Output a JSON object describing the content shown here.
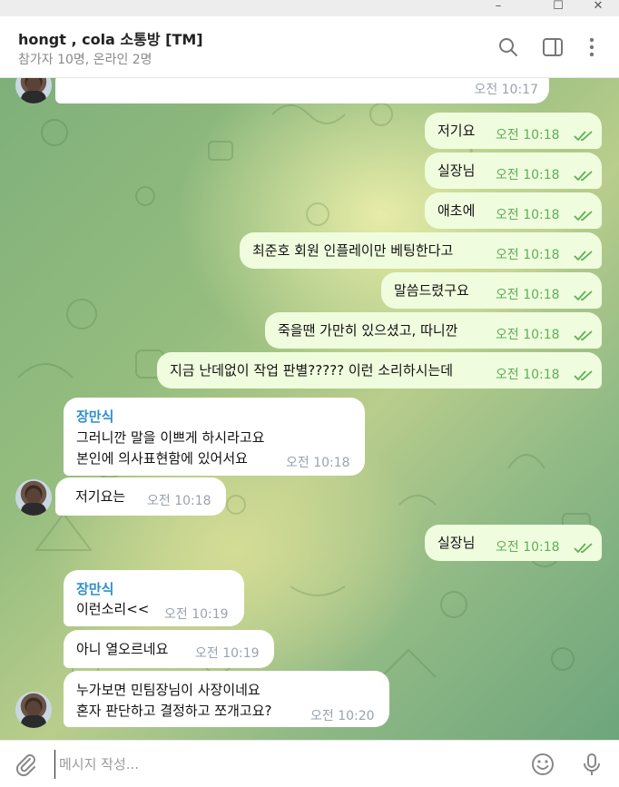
{
  "window": {
    "minimize": "–",
    "maximize": "☐",
    "close": "✕"
  },
  "header": {
    "title": "hongt , cola 소통방 [TM]",
    "subtitle": "참가자 10명, 온라인 2명"
  },
  "messages": [
    {
      "dir": "in",
      "text": "",
      "time": "오전 10:17"
    },
    {
      "dir": "out",
      "text": "저기요",
      "time": "오전 10:18"
    },
    {
      "dir": "out",
      "text": "실장님",
      "time": "오전 10:18"
    },
    {
      "dir": "out",
      "text": "애초에",
      "time": "오전 10:18"
    },
    {
      "dir": "out",
      "text": "최준호 회원 인플레이만 베팅한다고",
      "time": "오전 10:18"
    },
    {
      "dir": "out",
      "text": "말씀드렸구요",
      "time": "오전 10:18"
    },
    {
      "dir": "out",
      "text": "죽을땐 가만히 있으셨고, 따니깐",
      "time": "오전 10:18"
    },
    {
      "dir": "out",
      "text": "지금 난데없이 작업 판별????? 이런 소리하시는데",
      "time": "오전 10:18"
    },
    {
      "dir": "in",
      "sender": "장만식",
      "line1": "그러니깐 말을 이쁘게 하시라고요",
      "line2": "본인에 의사표현함에 있어서요",
      "time": "오전 10:18"
    },
    {
      "dir": "in",
      "text": "저기요는",
      "time": "오전 10:18"
    },
    {
      "dir": "out",
      "text": "실장님",
      "time": "오전 10:18"
    },
    {
      "dir": "in",
      "sender": "장만식",
      "text": "이런소리<<",
      "time": "오전 10:19"
    },
    {
      "dir": "in",
      "text": "아니 열오르네요",
      "time": "오전 10:19"
    },
    {
      "dir": "in",
      "line1": "누가보면 민팀장님이 사장이네요",
      "line2": "혼자 판단하고 결정하고 쪼개고요?",
      "time": "오전 10:20"
    }
  ],
  "composer": {
    "placeholder": "메시지 작성..."
  },
  "colors": {
    "outgoing": "#effdde",
    "incoming": "#ffffff",
    "sender": "#2f8fc9",
    "check": "#5fae55"
  }
}
